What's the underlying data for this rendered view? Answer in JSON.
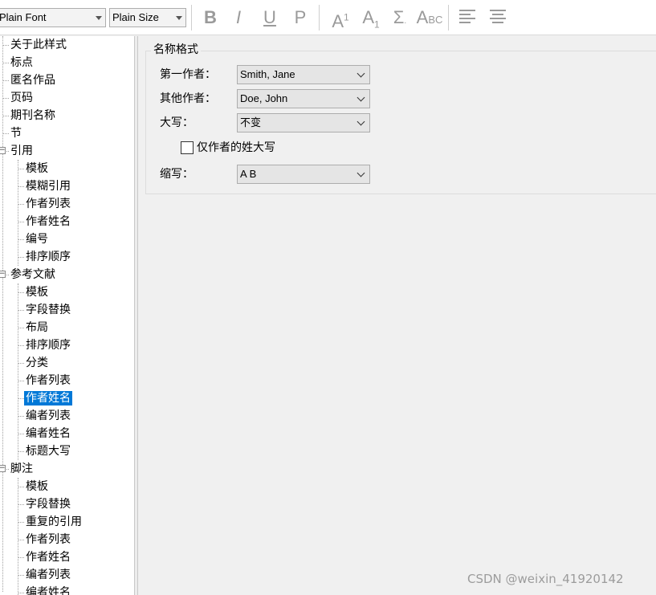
{
  "toolbar": {
    "font_combo": "Plain Font",
    "size_combo": "Plain Size",
    "buttons": {
      "bold": "B",
      "italic": "I",
      "underline": "U",
      "plain": "P",
      "superscript": "A",
      "superscript_mark": "1",
      "subscript": "A",
      "subscript_mark": "1",
      "symbol": "Σ",
      "smallcaps_big": "A",
      "smallcaps_small": "BC"
    },
    "icons": [
      "align-left-icon",
      "align-center-icon"
    ]
  },
  "tree": {
    "items": [
      {
        "label": "关于此样式"
      },
      {
        "label": "标点"
      },
      {
        "label": "匿名作品"
      },
      {
        "label": "页码"
      },
      {
        "label": "期刊名称"
      },
      {
        "label": "节"
      },
      {
        "label": "引用",
        "expander": "−"
      },
      {
        "label": "模板"
      },
      {
        "label": "模糊引用"
      },
      {
        "label": "作者列表"
      },
      {
        "label": "作者姓名"
      },
      {
        "label": "编号"
      },
      {
        "label": "排序顺序"
      },
      {
        "label": "参考文献",
        "expander": "−"
      },
      {
        "label": "模板"
      },
      {
        "label": "字段替换"
      },
      {
        "label": "布局"
      },
      {
        "label": "排序顺序"
      },
      {
        "label": "分类"
      },
      {
        "label": "作者列表"
      },
      {
        "label": "作者姓名",
        "selected": true
      },
      {
        "label": "编者列表"
      },
      {
        "label": "编者姓名"
      },
      {
        "label": "标题大写"
      },
      {
        "label": "脚注",
        "expander": "−"
      },
      {
        "label": "模板"
      },
      {
        "label": "字段替换"
      },
      {
        "label": "重复的引用"
      },
      {
        "label": "作者列表"
      },
      {
        "label": "作者姓名"
      },
      {
        "label": "编者列表"
      },
      {
        "label": "编者姓名"
      }
    ]
  },
  "form": {
    "group_title": "名称格式",
    "first_author_label": "第一作者：",
    "first_author_value": "Smith, Jane",
    "other_authors_label": "其他作者：",
    "other_authors_value": "Doe, John",
    "capitalization_label": "大写：",
    "capitalization_value": "不变",
    "checkbox_label": "仅作者的姓大写",
    "checkbox_checked": false,
    "abbrev_label": "缩写：",
    "abbrev_value": "A B"
  },
  "watermark": "CSDN @weixin_41920142",
  "colors": {
    "selection": "#0078d7",
    "toolbar_icon": "#9a9a9a"
  }
}
